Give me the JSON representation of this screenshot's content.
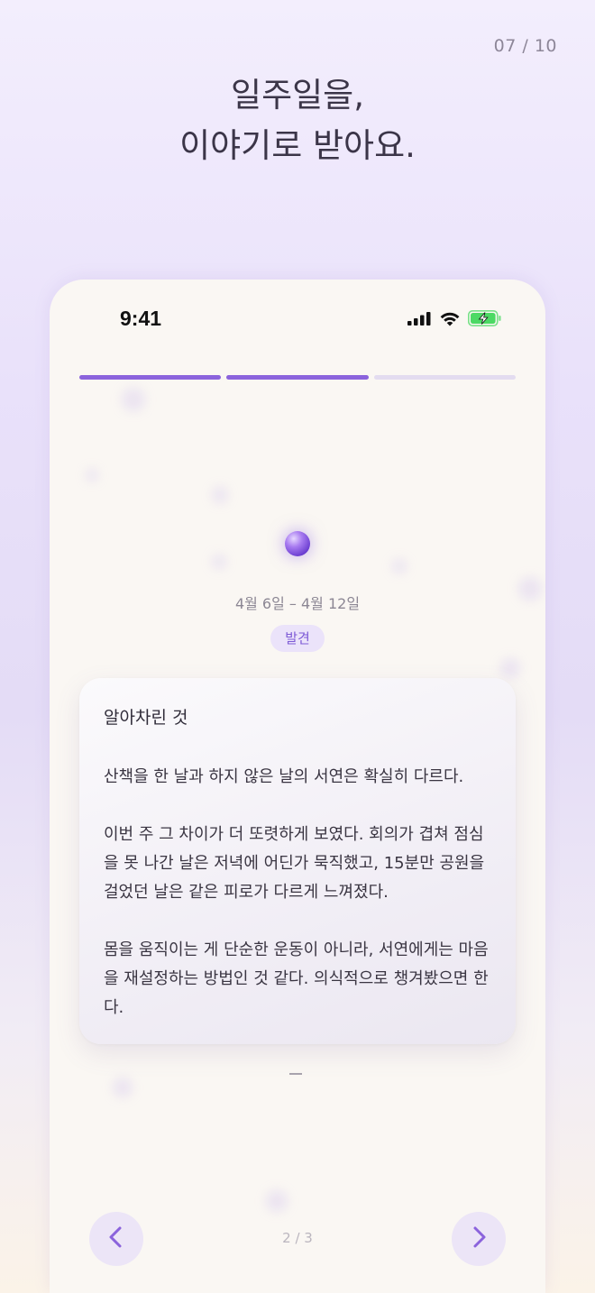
{
  "page_counter": "07 / 10",
  "headline": {
    "line1": "일주일을,",
    "line2": "이야기로 받아요."
  },
  "status_bar": {
    "time": "9:41",
    "icons": [
      "cellular-signal-icon",
      "wifi-icon",
      "battery-charging-icon"
    ]
  },
  "progress": {
    "total_segments": 3,
    "active_segments": 2
  },
  "week": {
    "date_range": "4월 6일 – 4월 12일",
    "badge": "발견"
  },
  "card": {
    "title": "알아차린 것",
    "paragraphs": [
      "산책을 한 날과 하지 않은 날의 서연은 확실히 다르다.",
      "이번 주 그 차이가 더 또렷하게 보였다. 회의가 겹쳐 점심을 못 나간 날은 저녁에 어딘가 묵직했고, 15분만 공원을 걸었던 날은 같은 피로가 다르게 느껴졌다.",
      "몸을 움직이는 게 단순한 운동이 아니라, 서연에게는 마음을 재설정하는 방법인 것 같다. 의식적으로 챙겨봤으면 한다."
    ]
  },
  "footer_dash": "–",
  "pager": {
    "indicator": "2 / 3",
    "prev_icon": "chevron-left-icon",
    "next_icon": "chevron-right-icon"
  },
  "colors": {
    "accent": "#8b63dc",
    "badge_bg": "#ebe3fa",
    "battery_green": "#4cd964"
  }
}
